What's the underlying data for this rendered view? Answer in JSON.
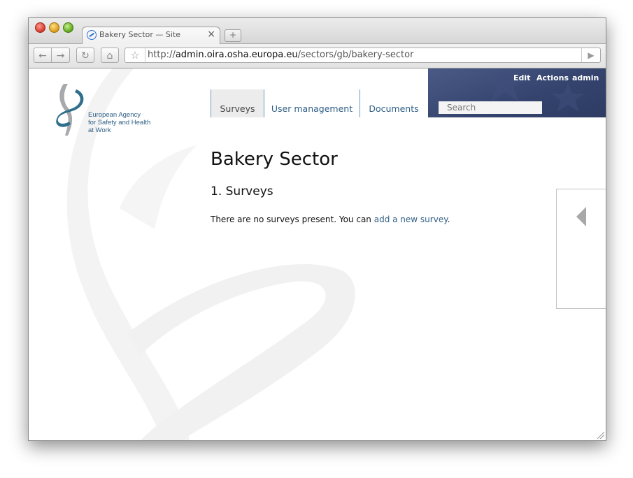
{
  "browser": {
    "tab_title": "Bakery Sector — Site",
    "tab_close": "×",
    "new_tab": "+",
    "url_prefix": "http://",
    "url_host": "admin.oira.osha.europa.eu",
    "url_path": "/sectors/gb/bakery-sector"
  },
  "site": {
    "logo_text": "European Agency\nfor Safety and Health\nat Work",
    "nav": [
      {
        "label": "Surveys"
      },
      {
        "label": "User management"
      },
      {
        "label": "Documents"
      }
    ],
    "header_links": {
      "edit": "Edit",
      "actions": "Actions",
      "admin": "admin"
    },
    "search_placeholder": "Search"
  },
  "content": {
    "title": "Bakery Sector",
    "section_heading": "1. Surveys",
    "message_before": "There are no surveys present. You can ",
    "message_link": "add a new survey",
    "message_after": "."
  },
  "colors": {
    "link": "#2f5f86",
    "header_band": "#34436d"
  }
}
